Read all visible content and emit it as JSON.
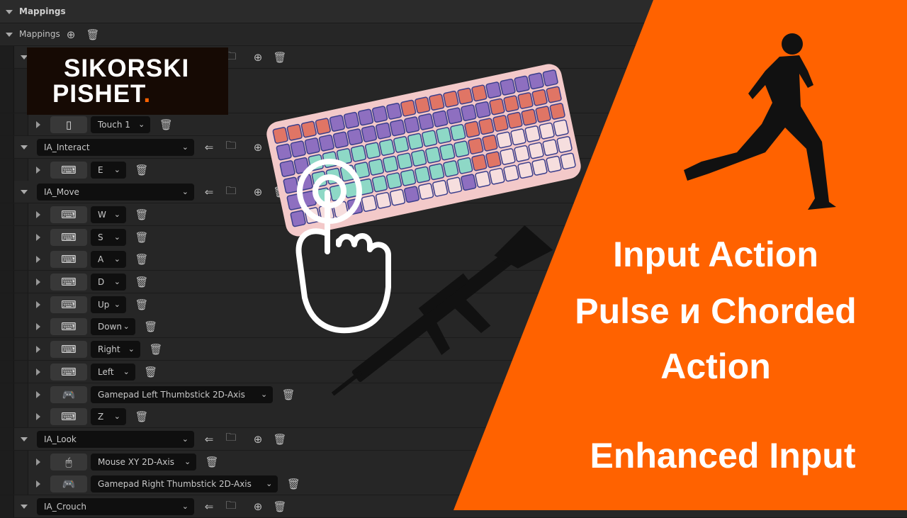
{
  "header": {
    "title": "Mappings"
  },
  "mappings_row": {
    "label": "Mappings"
  },
  "rows": [
    {
      "type": "action",
      "label": ""
    },
    {
      "type": "key",
      "icon": "keyboard",
      "label": ""
    },
    {
      "type": "key",
      "icon": "keyboard",
      "label": ""
    },
    {
      "type": "key",
      "icon": "touch",
      "label": "Touch 1"
    },
    {
      "type": "action",
      "label": "IA_Interact"
    },
    {
      "type": "key",
      "icon": "keyboard",
      "label": "E"
    },
    {
      "type": "action",
      "label": "IA_Move"
    },
    {
      "type": "key",
      "icon": "keyboard",
      "label": "W"
    },
    {
      "type": "key",
      "icon": "keyboard",
      "label": "S"
    },
    {
      "type": "key",
      "icon": "keyboard",
      "label": "A"
    },
    {
      "type": "key",
      "icon": "keyboard",
      "label": "D"
    },
    {
      "type": "key",
      "icon": "keyboard",
      "label": "Up"
    },
    {
      "type": "key",
      "icon": "keyboard",
      "label": "Down"
    },
    {
      "type": "key",
      "icon": "keyboard",
      "label": "Right"
    },
    {
      "type": "key",
      "icon": "keyboard",
      "label": "Left"
    },
    {
      "type": "key",
      "icon": "gamepad",
      "label": "Gamepad Left Thumbstick 2D-Axis"
    },
    {
      "type": "key",
      "icon": "keyboard",
      "label": "Z"
    },
    {
      "type": "action",
      "label": "IA_Look"
    },
    {
      "type": "key",
      "icon": "mouse",
      "label": "Mouse XY 2D-Axis"
    },
    {
      "type": "key",
      "icon": "gamepad",
      "label": "Gamepad Right Thumbstick 2D-Axis"
    },
    {
      "type": "action",
      "label": "IA_Crouch"
    }
  ],
  "logo": {
    "line1": "SIKORSKI",
    "line2": "PISHET",
    "dot": "."
  },
  "banner": {
    "line1": "Input Action",
    "line2": "Pulse и Chorded",
    "line3": "Action",
    "subtitle": "Enhanced Input"
  },
  "colors": {
    "accent": "#FF6200",
    "panel": "#232323"
  }
}
